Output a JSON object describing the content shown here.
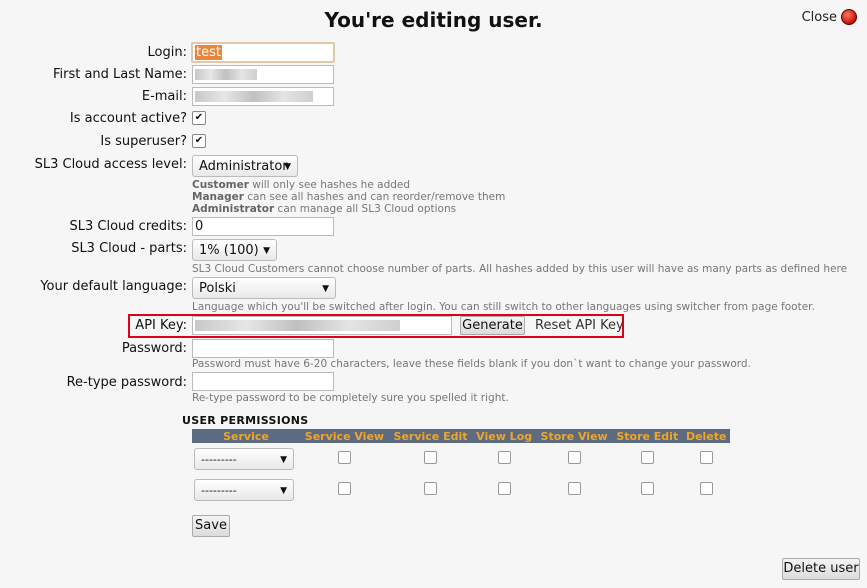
{
  "header": {
    "title": "You're editing user.",
    "close_label": "Close"
  },
  "form": {
    "login": {
      "label": "Login:",
      "value": "test"
    },
    "name": {
      "label": "First and Last Name:"
    },
    "email": {
      "label": "E-mail:"
    },
    "active": {
      "label": "Is account active?",
      "checked": "✔"
    },
    "superuser": {
      "label": "Is superuser?",
      "checked": "✔"
    },
    "access": {
      "label": "SL3 Cloud access level:",
      "value": "Administrator",
      "hint1_strong": "Customer",
      "hint1": " will only see hashes he added",
      "hint2_strong": "Manager",
      "hint2": " can see all hashes and can reorder/remove them",
      "hint3_strong": "Administrator",
      "hint3": " can manage all SL3 Cloud options"
    },
    "credits": {
      "label": "SL3 Cloud credits:",
      "value": "0"
    },
    "parts": {
      "label": "SL3 Cloud - parts:",
      "value": "1% (100)",
      "hint": "SL3 Cloud Customers cannot choose number of parts. All hashes added by this user will have as many parts as defined here"
    },
    "language": {
      "label": "Your default language:",
      "value": "Polski",
      "hint": "Language which you'll be switched after login. You can still switch to other languages using switcher from page footer."
    },
    "api": {
      "label": "API Key:",
      "generate": "Generate",
      "reset": "Reset API Key"
    },
    "password": {
      "label": "Password:",
      "hint": "Password must have 6-20 characters, leave these fields blank if you don`t want to change your password."
    },
    "retype": {
      "label": "Re-type password:",
      "hint": "Re-type password to be completely sure you spelled it right."
    }
  },
  "permissions": {
    "title": "USER PERMISSIONS",
    "columns": [
      "Service",
      "Service View",
      "Service Edit",
      "View Log",
      "Store View",
      "Store Edit",
      "Delete"
    ],
    "rows": [
      {
        "service": "---------"
      },
      {
        "service": "---------"
      }
    ]
  },
  "buttons": {
    "save": "Save",
    "delete_user": "Delete user"
  },
  "colors": {
    "header_bg": "#5c6b80",
    "header_text": "#f0a42a",
    "highlight_border": "#e0001b"
  }
}
